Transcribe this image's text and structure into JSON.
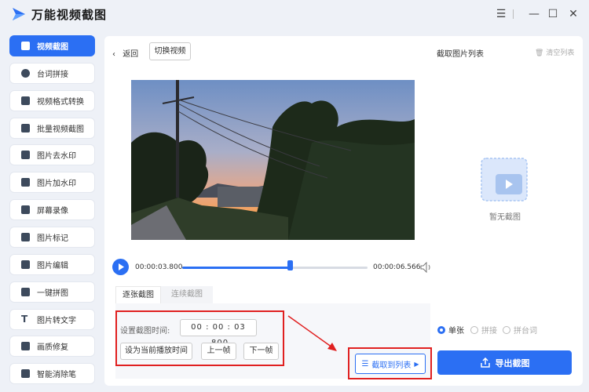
{
  "app": {
    "title": "万能视频截图"
  },
  "sidebar": {
    "items": [
      {
        "label": "视频截图",
        "active": true,
        "icon": "video-screenshot-icon"
      },
      {
        "label": "台词拼接",
        "active": false,
        "icon": "subtitle-join-icon"
      },
      {
        "label": "视频格式转换",
        "active": false,
        "icon": "format-convert-icon"
      },
      {
        "label": "批量视频截图",
        "active": false,
        "icon": "batch-screenshot-icon"
      },
      {
        "label": "图片去水印",
        "active": false,
        "icon": "remove-watermark-icon"
      },
      {
        "label": "图片加水印",
        "active": false,
        "icon": "add-watermark-icon"
      },
      {
        "label": "屏幕录像",
        "active": false,
        "icon": "screen-record-icon"
      },
      {
        "label": "图片标记",
        "active": false,
        "icon": "image-mark-icon"
      },
      {
        "label": "图片编辑",
        "active": false,
        "icon": "image-edit-icon"
      },
      {
        "label": "一键拼图",
        "active": false,
        "icon": "collage-icon"
      },
      {
        "label": "图片转文字",
        "active": false,
        "icon": "text-icon"
      },
      {
        "label": "画质修复",
        "active": false,
        "icon": "quality-repair-icon"
      },
      {
        "label": "智能消除笔",
        "active": false,
        "icon": "eraser-icon"
      }
    ]
  },
  "toolbar": {
    "back_label": "返回",
    "switch_label": "切换视频"
  },
  "list_panel": {
    "title": "截取图片列表",
    "clear_label": "清空列表",
    "empty_text": "暂无截图"
  },
  "player": {
    "current_time": "00:00:03.800",
    "end_time": "00:00:06.566",
    "progress": 0.58
  },
  "tabs": {
    "single": "逐张截图",
    "continuous": "连续截图"
  },
  "capture": {
    "time_label": "设置截图时间:",
    "time_value": "00 : 00 : 03 .800",
    "set_current": "设为当前播放时间",
    "prev_frame": "上一帧",
    "next_frame": "下一帧",
    "capture_to_list": "截取到列表"
  },
  "mode": {
    "single": "单张",
    "join": "拼接",
    "subtitle_join": "拼台词",
    "selected": "single"
  },
  "export": {
    "label": "导出截图"
  },
  "colors": {
    "accent": "#2b6ff3",
    "annotation": "#e02020"
  }
}
